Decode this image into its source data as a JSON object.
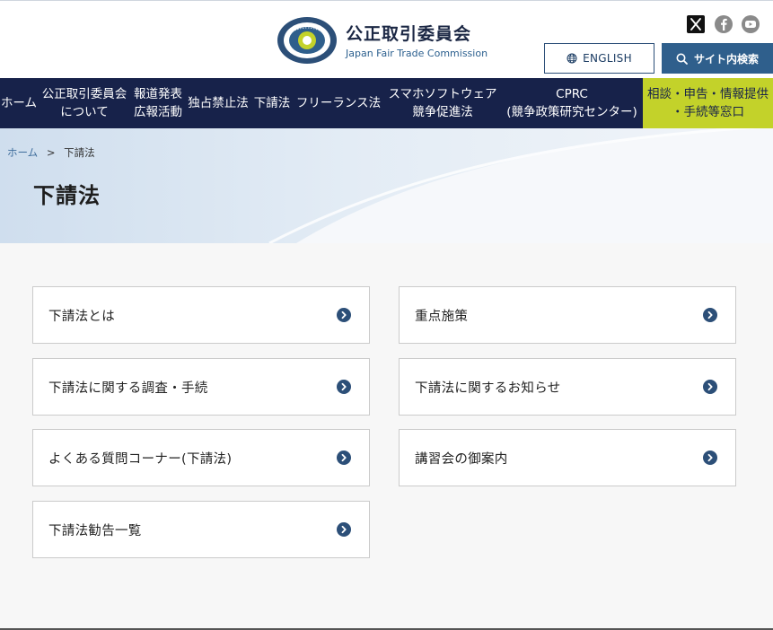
{
  "header": {
    "org_name_jp": "公正取引委員会",
    "org_name_en": "Japan Fair Trade Commission",
    "emblem_ring_text": "JAPAN FAIR TRADE COMMISSION",
    "social": [
      {
        "icon": "x-icon",
        "label": "X"
      },
      {
        "icon": "facebook-icon",
        "label": "Facebook"
      },
      {
        "icon": "youtube-icon",
        "label": "YouTube"
      }
    ],
    "english_button": "ENGLISH",
    "search_button": "サイト内検索"
  },
  "nav": {
    "items": [
      {
        "line1": "ホーム",
        "line2": ""
      },
      {
        "line1": "公正取引委員会",
        "line2": "について"
      },
      {
        "line1": "報道発表",
        "line2": "広報活動"
      },
      {
        "line1": "独占禁止法",
        "line2": ""
      },
      {
        "line1": "下請法",
        "line2": ""
      },
      {
        "line1": "フリーランス法",
        "line2": ""
      },
      {
        "line1": "スマホソフトウェア",
        "line2": "競争促進法"
      },
      {
        "line1": "CPRC",
        "line2": "(競争政策研究センター)"
      },
      {
        "line1": "相談・申告・情報提供",
        "line2": "・手続等窓口"
      }
    ]
  },
  "breadcrumb": {
    "home": "ホーム",
    "separator": ">",
    "current": "下請法"
  },
  "page_title": "下請法",
  "cards": [
    {
      "label": "下請法とは"
    },
    {
      "label": "重点施策"
    },
    {
      "label": "下請法に関する調査・手続"
    },
    {
      "label": "下請法に関するお知らせ"
    },
    {
      "label": "よくある質問コーナー(下請法)"
    },
    {
      "label": "講習会の御案内"
    },
    {
      "label": "下請法勧告一覧"
    }
  ],
  "colors": {
    "navy": "#17224a",
    "accent_blue": "#2f5f8c",
    "consult_green": "#c3d22a",
    "emblem_green": "#c3d22a"
  }
}
